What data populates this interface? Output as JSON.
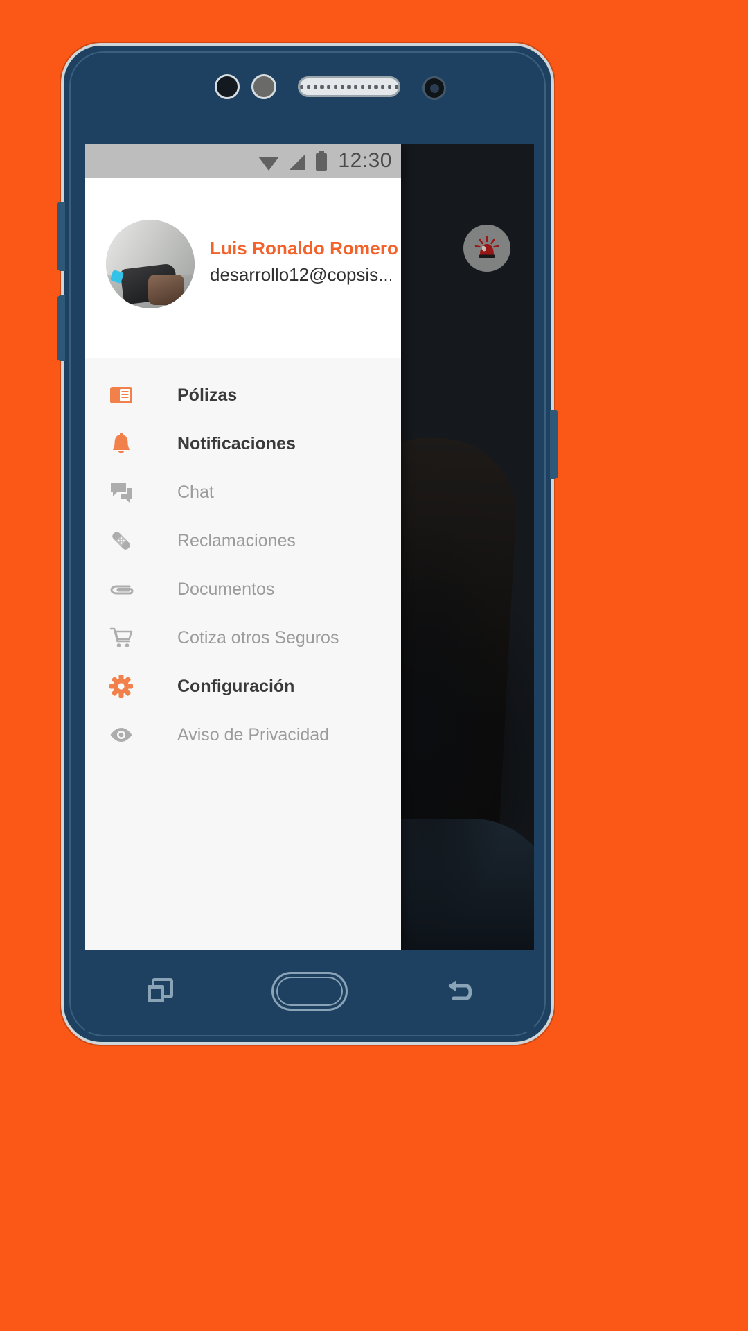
{
  "theme": {
    "wallpaper_color": "#fb5716",
    "phone_body_color": "#1f4161",
    "accent_orange": "#f2622a",
    "drawer_bg": "#f7f7f7",
    "status_bar_bg": "#bdbdbd",
    "inactive_gray": "#9b9b9b",
    "alarm_red": "#a31616"
  },
  "status_bar": {
    "time": "12:30",
    "icons": [
      "wifi-icon",
      "cellular-signal-icon",
      "battery-icon"
    ]
  },
  "drawer": {
    "user": {
      "name": "Luis Ronaldo Romero",
      "email": "desarrollo12@copsis....",
      "avatar_name": "user-avatar-photo"
    },
    "items": [
      {
        "label": "Pólizas",
        "icon": "policy-card-icon",
        "state": "active"
      },
      {
        "label": "Notificaciones",
        "icon": "bell-icon",
        "state": "active"
      },
      {
        "label": "Chat",
        "icon": "chat-bubbles-icon",
        "state": "inactive"
      },
      {
        "label": "Reclamaciones",
        "icon": "bandage-icon",
        "state": "inactive"
      },
      {
        "label": "Documentos",
        "icon": "paperclip-icon",
        "state": "inactive"
      },
      {
        "label": "Cotiza otros Seguros",
        "icon": "shopping-cart-icon",
        "state": "inactive"
      },
      {
        "label": "Configuración",
        "icon": "gear-icon",
        "state": "active"
      },
      {
        "label": "Aviso de Privacidad",
        "icon": "eye-icon",
        "state": "inactive"
      }
    ]
  },
  "app_background": {
    "emergency_button_icon": "emergency-siren-icon"
  },
  "navigation_bar": {
    "buttons": [
      {
        "name": "recents-button",
        "icon": "recents-squares-icon"
      },
      {
        "name": "home-button",
        "icon": "home-pill-icon"
      },
      {
        "name": "back-button",
        "icon": "back-arrow-icon"
      }
    ]
  }
}
